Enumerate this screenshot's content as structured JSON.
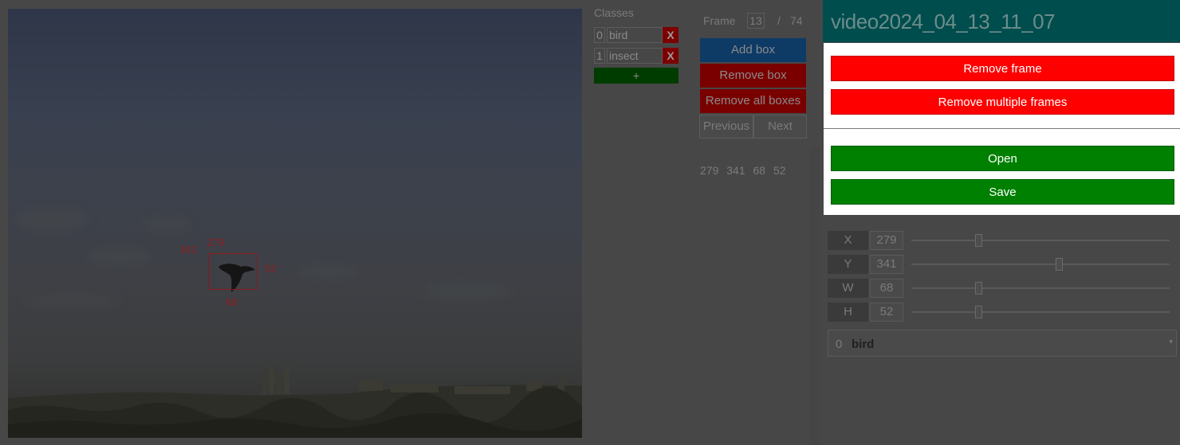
{
  "image": {
    "box_labels": {
      "x": "279",
      "y": "341",
      "w": "68",
      "h": "52"
    }
  },
  "classes": {
    "title": "Classes",
    "items": [
      {
        "index": "0",
        "name": "bird",
        "delete_label": "X"
      },
      {
        "index": "1",
        "name": "insect",
        "delete_label": "X"
      }
    ],
    "add_label": "+"
  },
  "frame": {
    "label": "Frame",
    "current": "13",
    "separator": "/",
    "total": "74"
  },
  "actions": {
    "add_box": "Add box",
    "remove_box": "Remove box",
    "remove_all_boxes": "Remove all boxes",
    "previous": "Previous",
    "next": "Next"
  },
  "coords_readout": "279 341 68 52",
  "header": {
    "title": "video2024_04_13_11_07"
  },
  "menu": {
    "remove_frame": "Remove frame",
    "remove_multiple_frames": "Remove multiple frames",
    "open": "Open",
    "save": "Save"
  },
  "sliders": [
    {
      "key": "X",
      "value": "279",
      "level": 0.26
    },
    {
      "key": "Y",
      "value": "341",
      "level": 0.57
    },
    {
      "key": "W",
      "value": "68",
      "level": 0.26
    },
    {
      "key": "H",
      "value": "52",
      "level": 0.26
    }
  ],
  "class_select": {
    "index": "0",
    "name": "bird"
  },
  "colors": {
    "menu_red": "#ff0000",
    "menu_green": "#008000",
    "header_teal": "#004d4d"
  }
}
